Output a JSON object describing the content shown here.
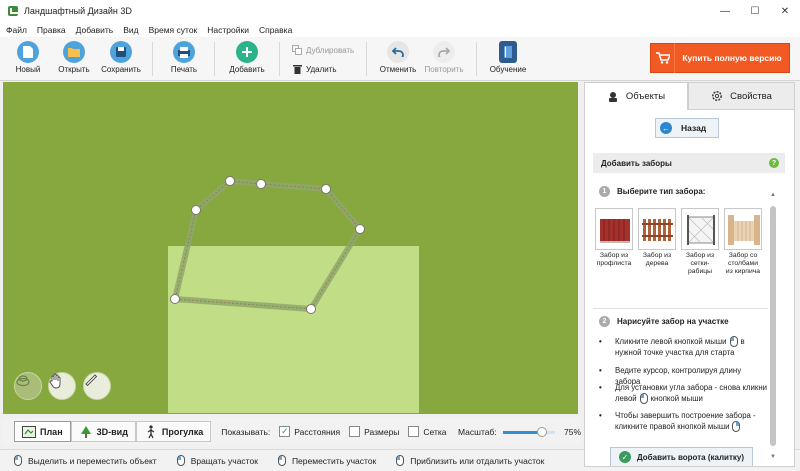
{
  "window": {
    "title": "Ландшафтный Дизайн 3D",
    "controls": [
      "—",
      "☐",
      "✕"
    ]
  },
  "menu": [
    "Файл",
    "Правка",
    "Добавить",
    "Вид",
    "Время суток",
    "Настройки",
    "Справка"
  ],
  "toolbar": {
    "new_label": "Новый",
    "open_label": "Открыть",
    "save_label": "Сохранить",
    "print_label": "Печать",
    "add_label": "Добавить",
    "duplicate_label": "Дублировать",
    "delete_label": "Удалить",
    "undo_label": "Отменить",
    "redo_label": "Повторить",
    "learn_label": "Обучение",
    "buy_label": "Купить полную версию"
  },
  "viewbar": {
    "tab_plan": "План",
    "tab_3d": "3D-вид",
    "tab_walk": "Прогулка",
    "show_label": "Показывать:",
    "chk_distances": "Расстояния",
    "chk_sizes": "Размеры",
    "chk_grid": "Сетка",
    "distances_checked": true,
    "sizes_checked": false,
    "grid_checked": false,
    "scale_label": "Масштаб:",
    "scale_value": "75%",
    "scale_fraction": 0.75
  },
  "statusbar": {
    "hint1": "Выделить и переместить объект",
    "hint2": "Вращать участок",
    "hint3": "Переместить участок",
    "hint4": "Приблизить или отдалить участок"
  },
  "panel": {
    "tab_objects": "Объекты",
    "tab_properties": "Свойства",
    "back_label": "Назад",
    "section_title": "Добавить заборы",
    "help_glyph": "?",
    "step1_num": "1",
    "step1_title": "Выберите тип забора:",
    "fences": [
      {
        "caption": "Забор из профлиста"
      },
      {
        "caption": "Забор из дерева"
      },
      {
        "caption": "Забор из сетки-рабицы"
      },
      {
        "caption": "Забор со столбами из кирпича"
      }
    ],
    "step2_num": "2",
    "step2_title": "Нарисуйте забор на участке",
    "b1_pre": "Кликните левой кнопкой мыши",
    "b1_mid": "в",
    "b1_post": "нужной точке участка для старта",
    "b2": "Ведите курсор, контролируя длину забора",
    "b3_pre": "Для установки угла забора - снова кликни",
    "b3_mid": "левой",
    "b3_post": "кнопкой мыши",
    "b4_pre": "Чтобы завершить построение забора -",
    "b4_post": "кликните правой кнопкой мыши",
    "gate_label": "Добавить ворота (калитку)"
  },
  "colors": {
    "grass": "#86a83e",
    "plot": "#c1dd85",
    "buy": "#f15a22",
    "accent_blue": "#2d87cf"
  }
}
